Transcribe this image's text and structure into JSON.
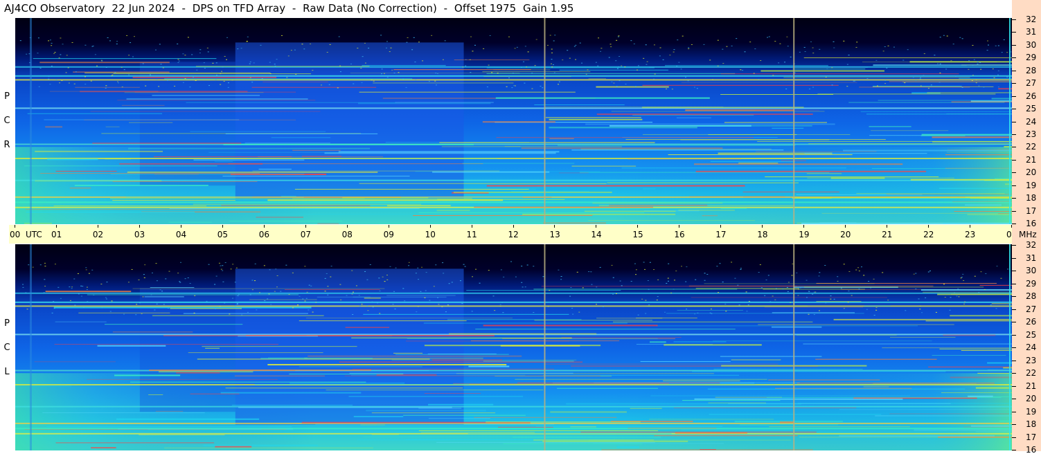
{
  "title": "AJ4CO Observatory  22 Jun 2024  -  DPS on TFD Array  -  Raw Data (No Correction)  -  Offset 1975  Gain 1.95",
  "panels": {
    "top": {
      "letters": [
        "R",
        "C",
        "P"
      ]
    },
    "bottom": {
      "letters": [
        "L",
        "C",
        "P"
      ]
    }
  },
  "time_axis": {
    "labels": [
      "00",
      "01",
      "02",
      "03",
      "04",
      "05",
      "06",
      "07",
      "08",
      "09",
      "10",
      "11",
      "12",
      "13",
      "14",
      "15",
      "16",
      "17",
      "18",
      "19",
      "20",
      "21",
      "22",
      "23",
      "00"
    ],
    "unit": "UTC"
  },
  "freq_axis": {
    "labels": [
      "16",
      "17",
      "18",
      "19",
      "20",
      "21",
      "22",
      "23",
      "24",
      "25",
      "26",
      "27",
      "28",
      "29",
      "30",
      "31",
      "32"
    ],
    "unit": "MHz"
  },
  "colors": {
    "background_dark": "#000018",
    "mid_blue": "#0a50d8",
    "cyan": "#19c8e6",
    "yellow": "#e6f032",
    "time_axis_bg": "#ffffc8",
    "freq_axis_bg": "#ffdcc4"
  },
  "chart_data": {
    "type": "heatmap",
    "title": "AJ4CO Observatory  22 Jun 2024  -  DPS on TFD Array  -  Raw Data (No Correction)  -  Offset 1975  Gain 1.95",
    "x_label": "UTC",
    "y_label": "MHz",
    "x_range": [
      0,
      24
    ],
    "y_range": [
      16,
      32
    ],
    "panels": [
      "RCP",
      "LCP"
    ],
    "vertical_markers_utc": [
      12.75,
      18.75,
      23.95
    ],
    "persistent_lines_mhz": [
      17.3,
      17.7,
      18.1,
      19.4,
      21.1,
      22.2,
      25.0,
      27.2,
      27.5,
      28.2
    ]
  }
}
